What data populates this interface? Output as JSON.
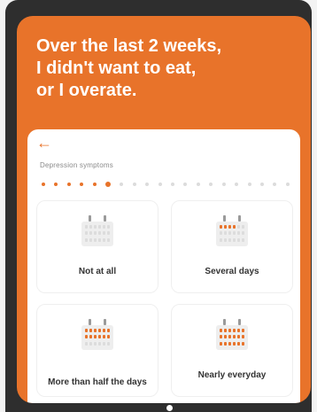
{
  "question": {
    "line1": "Over the last 2 weeks,",
    "line2": "I didn't want to eat,",
    "line3": "or I overate."
  },
  "card": {
    "back_icon": "arrow-left-icon",
    "back_glyph": "←",
    "section_label": "Depression symptoms",
    "progress": {
      "total": 20,
      "current": 6
    }
  },
  "options": [
    {
      "label": "Not at all",
      "highlighted_days": 0
    },
    {
      "label": "Several days",
      "highlighted_days": 4
    },
    {
      "label": "More than half the days",
      "highlighted_days": 12
    },
    {
      "label": "Nearly everyday",
      "highlighted_days": 18
    }
  ],
  "colors": {
    "accent": "#e8732a",
    "device": "#2e2e2e",
    "card": "#ffffff"
  }
}
